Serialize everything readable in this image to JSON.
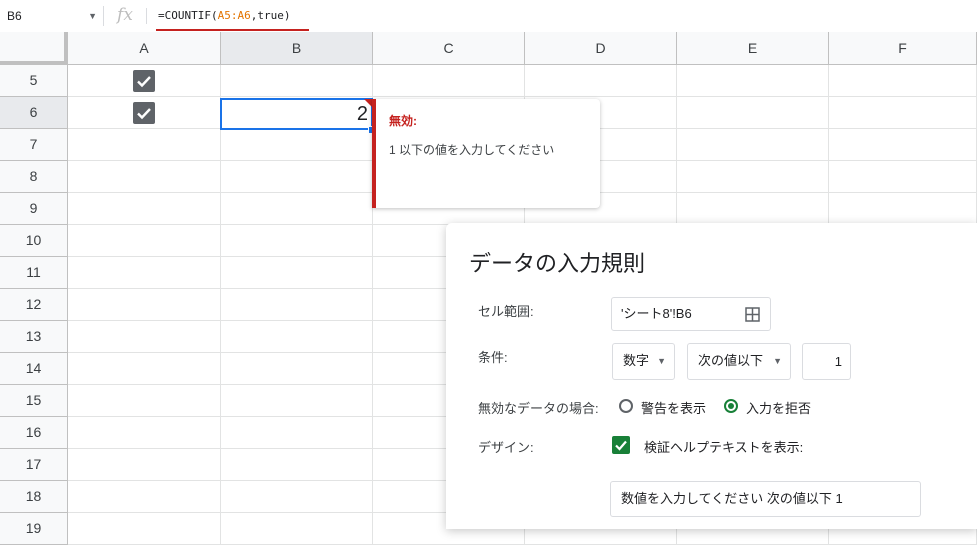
{
  "formula_bar": {
    "cell_ref": "B6",
    "fx": "fx",
    "formula_prefix": "=COUNTIF(",
    "formula_range": "A5:A6",
    "formula_suffix": ",true)"
  },
  "columns": [
    "A",
    "B",
    "C",
    "D",
    "E",
    "F"
  ],
  "rows": [
    "5",
    "6",
    "7",
    "8",
    "9",
    "10",
    "11",
    "12",
    "13",
    "14",
    "15",
    "16",
    "17",
    "18",
    "19"
  ],
  "cells": {
    "a5_checked": true,
    "a6_checked": true,
    "b6_value": "2"
  },
  "invalid_tooltip": {
    "title": "無効:",
    "message": "1 以下の値を入力してください"
  },
  "validation_panel": {
    "title": "データの入力規則",
    "range_label": "セル範囲:",
    "range_value": "'シート8'!B6",
    "criteria_label": "条件:",
    "criteria_type": "数字",
    "criteria_op": "次の値以下",
    "criteria_value": "1",
    "invalid_label": "無効なデータの場合:",
    "option_warn": "警告を表示",
    "option_reject": "入力を拒否",
    "selected_option": "reject",
    "design_label": "デザイン:",
    "show_help_label": "検証ヘルプテキストを表示:",
    "show_help_checked": true,
    "help_text": "数値を入力してください 次の値以下 1"
  },
  "colors": {
    "accent_blue": "#1a73e8",
    "error_red": "#c5221f",
    "range_orange": "#e37400",
    "check_green": "#188038"
  }
}
